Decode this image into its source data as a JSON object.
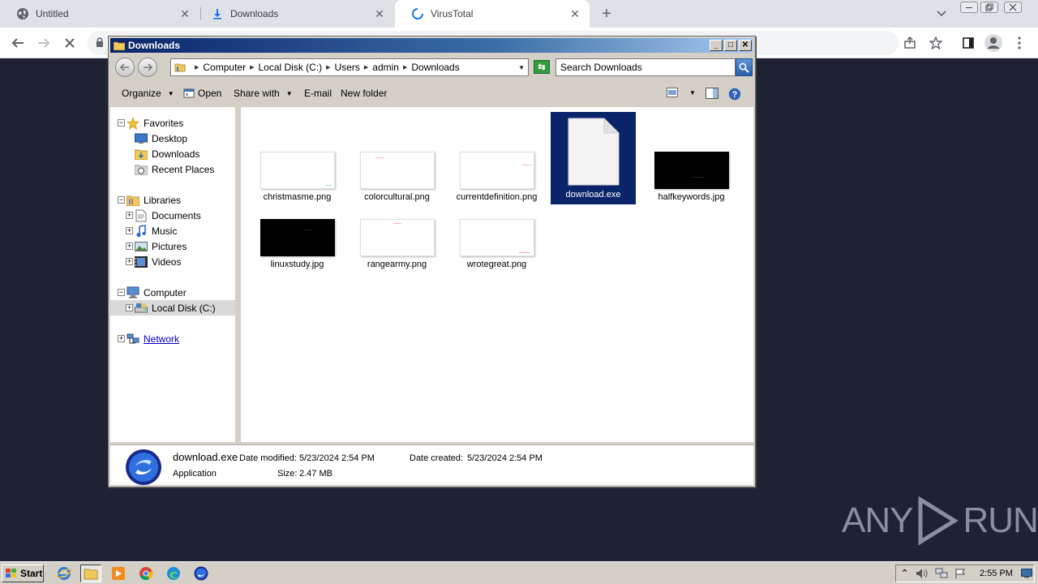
{
  "browser": {
    "tabs": [
      {
        "title": "Untitled",
        "icon": "globe-icon"
      },
      {
        "title": "Downloads",
        "icon": "download-icon"
      },
      {
        "title": "VirusTotal",
        "icon": "loading-spinner-icon"
      }
    ],
    "new_tab_symbol": "+"
  },
  "explorer": {
    "title": "Downloads",
    "breadcrumbs": [
      "Computer",
      "Local Disk (C:)",
      "Users",
      "admin",
      "Downloads"
    ],
    "search_placeholder": "Search Downloads",
    "commands": {
      "organize": "Organize",
      "open": "Open",
      "share_with": "Share with",
      "email": "E-mail",
      "new_folder": "New folder"
    },
    "nav": {
      "favorites": "Favorites",
      "desktop": "Desktop",
      "downloads": "Downloads",
      "recent_places": "Recent Places",
      "libraries": "Libraries",
      "documents": "Documents",
      "music": "Music",
      "pictures": "Pictures",
      "videos": "Videos",
      "computer": "Computer",
      "local_disk": "Local Disk (C:)",
      "network": "Network"
    },
    "files": [
      {
        "name": "christmasme.png",
        "thumb": "light"
      },
      {
        "name": "colorcultural.png",
        "thumb": "light"
      },
      {
        "name": "currentdefinition.png",
        "thumb": "light"
      },
      {
        "name": "download.exe",
        "thumb": "document",
        "selected": true
      },
      {
        "name": "halfkeywords.jpg",
        "thumb": "dark"
      },
      {
        "name": "linuxstudy.jpg",
        "thumb": "dark"
      },
      {
        "name": "rangearmy.png",
        "thumb": "light"
      },
      {
        "name": "wrotegreat.png",
        "thumb": "light"
      }
    ],
    "details": {
      "file_name": "download.exe",
      "file_type": "Application",
      "modified_label": "Date modified:",
      "modified_value": "5/23/2024 2:54 PM",
      "size_label": "Size:",
      "size_value": "2.47 MB",
      "created_label": "Date created:",
      "created_value": "5/23/2024 2:54 PM"
    }
  },
  "watermark": {
    "left": "ANY",
    "right": "RUN"
  },
  "taskbar": {
    "start_label": "Start",
    "clock": "2:55 PM"
  }
}
